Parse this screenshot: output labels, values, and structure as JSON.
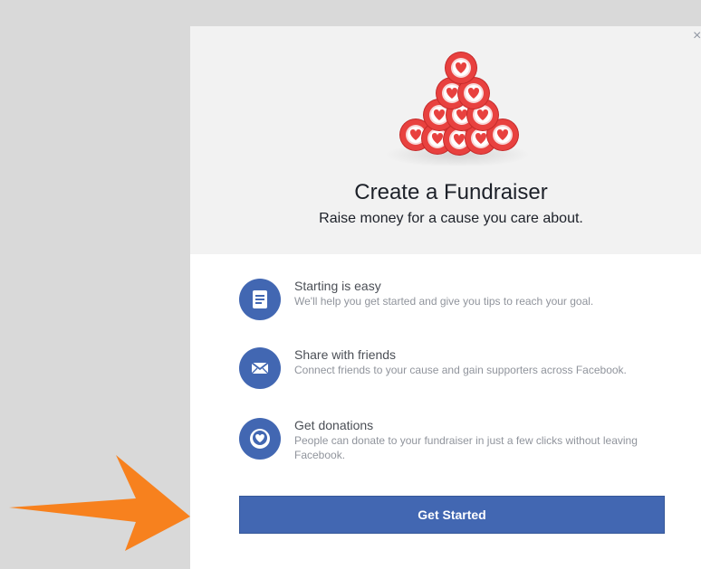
{
  "dialog": {
    "close_label": "×",
    "title": "Create a Fundraiser",
    "subtitle": "Raise money for a cause you care about.",
    "illustration": "stack-of-red-heart-coins",
    "features": [
      {
        "icon": "document-icon",
        "title": "Starting is easy",
        "description": "We'll help you get started and give you tips to reach your goal."
      },
      {
        "icon": "envelope-icon",
        "title": "Share with friends",
        "description": "Connect friends to your cause and gain supporters across Facebook."
      },
      {
        "icon": "heart-coin-icon",
        "title": "Get donations",
        "description": "People can donate to your fundraiser in just a few clicks without leaving Facebook."
      }
    ],
    "cta_label": "Get Started"
  },
  "colors": {
    "page_background": "#d9d9d9",
    "hero_background": "#f2f2f2",
    "brand_blue": "#4267b2",
    "heart_red": "#e8413f",
    "arrow_orange": "#f7811e"
  }
}
